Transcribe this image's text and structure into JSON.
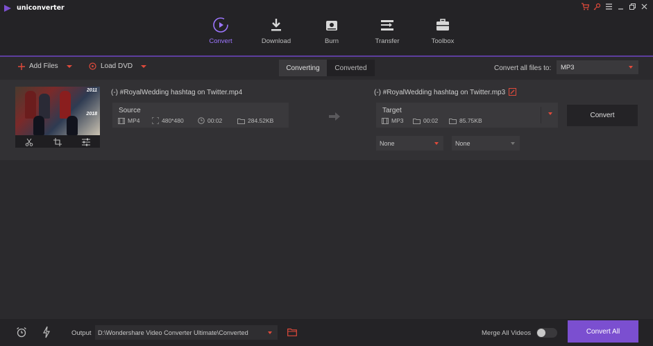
{
  "app": {
    "title": "uniconverter"
  },
  "nav": {
    "items": [
      {
        "label": "Convert",
        "icon": "convert-icon",
        "active": true
      },
      {
        "label": "Download",
        "icon": "download-icon"
      },
      {
        "label": "Burn",
        "icon": "disc-icon"
      },
      {
        "label": "Transfer",
        "icon": "transfer-icon"
      },
      {
        "label": "Toolbox",
        "icon": "toolbox-icon"
      }
    ]
  },
  "toolbar": {
    "add_files": "Add Files",
    "load_dvd": "Load DVD",
    "tabs": [
      {
        "label": "Converting",
        "active": true
      },
      {
        "label": "Converted"
      }
    ],
    "convert_all_label": "Convert all files to:",
    "format": "MP3"
  },
  "file": {
    "source_name": "(-) #RoyalWedding hashtag on Twitter.mp4",
    "source_label": "Source",
    "source_meta": {
      "format": "MP4",
      "resolution": "480*480",
      "duration": "00:02",
      "size": "284.52KB"
    },
    "thumb_badges": [
      "2011",
      "2018"
    ],
    "target_name": "(-) #RoyalWedding hashtag on Twitter.mp3",
    "target_label": "Target",
    "target_meta": {
      "format": "MP3",
      "duration": "00:02",
      "size": "85.75KB"
    },
    "convert_label": "Convert",
    "subtitle_select": "None",
    "audio_select": "None"
  },
  "bottom": {
    "output_label": "Output",
    "output_path": "D:\\Wondershare Video Converter Ultimate\\Converted",
    "merge_label": "Merge All Videos",
    "merge_on": false,
    "convert_all": "Convert All"
  },
  "colors": {
    "accent": "#7b4fd0",
    "accent_text": "#9d76ff",
    "alert": "#e04a3b"
  }
}
